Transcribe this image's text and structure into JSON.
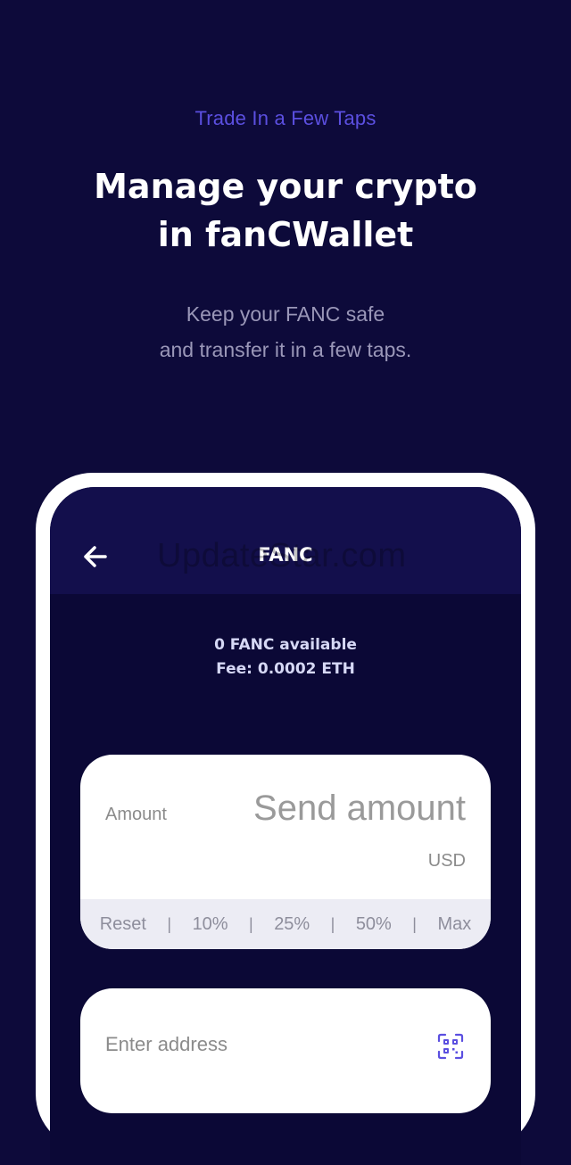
{
  "hero": {
    "eyebrow": "Trade In a Few Taps",
    "headline_line1": "Manage your crypto",
    "headline_line2": "in fanCWallet",
    "subline_line1": "Keep your FANC safe",
    "subline_line2": "and transfer it in a few taps."
  },
  "app": {
    "title": "FANC",
    "watermark": "UpdateStar.com",
    "available": "0 FANC available",
    "fee": "Fee: 0.0002 ETH",
    "amount": {
      "label": "Amount",
      "placeholder": "Send amount",
      "value": "",
      "currency": "USD",
      "presets": [
        "Reset",
        "10%",
        "25%",
        "50%",
        "Max"
      ]
    },
    "address": {
      "placeholder": "Enter address",
      "value": ""
    }
  },
  "colors": {
    "background": "#0d0a3a",
    "header": "#130f4c",
    "accent": "#5b4fe0",
    "card": "#ffffff",
    "preset_bar": "#ececf4"
  },
  "icons": {
    "back": "arrow-left-icon",
    "qr": "qr-scan-icon"
  }
}
